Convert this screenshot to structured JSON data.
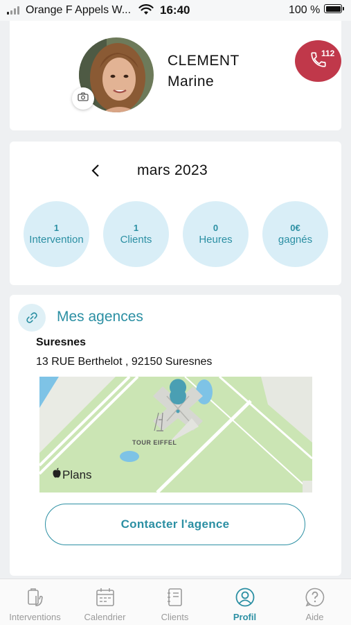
{
  "status_bar": {
    "carrier": "Orange F Appels W...",
    "time": "16:40",
    "battery": "100 %"
  },
  "profile": {
    "last_name": "CLEMENT",
    "first_name": "Marine",
    "emergency_number": "112"
  },
  "stats": {
    "month": "mars 2023",
    "items": [
      {
        "value": "1",
        "label": "Intervention"
      },
      {
        "value": "1",
        "label": "Clients"
      },
      {
        "value": "0",
        "label": "Heures"
      },
      {
        "value": "0€",
        "label": "gagnés"
      }
    ]
  },
  "agencies": {
    "title": "Mes agences",
    "name": "Suresnes",
    "address": "13 RUE Berthelot , 92150 Suresnes",
    "map_label": "TOUR EIFFEL",
    "map_provider": "Plans",
    "contact_label": "Contacter l'agence"
  },
  "tabs": [
    {
      "label": "Interventions",
      "icon": "interventions-icon"
    },
    {
      "label": "Calendrier",
      "icon": "calendar-icon"
    },
    {
      "label": "Clients",
      "icon": "clients-icon"
    },
    {
      "label": "Profil",
      "icon": "profile-icon",
      "active": true
    },
    {
      "label": "Aide",
      "icon": "help-icon"
    }
  ],
  "colors": {
    "accent": "#2b8fa3",
    "emergency": "#c0384a",
    "stat_bg": "#d9eef7",
    "background": "#eef0f2"
  }
}
